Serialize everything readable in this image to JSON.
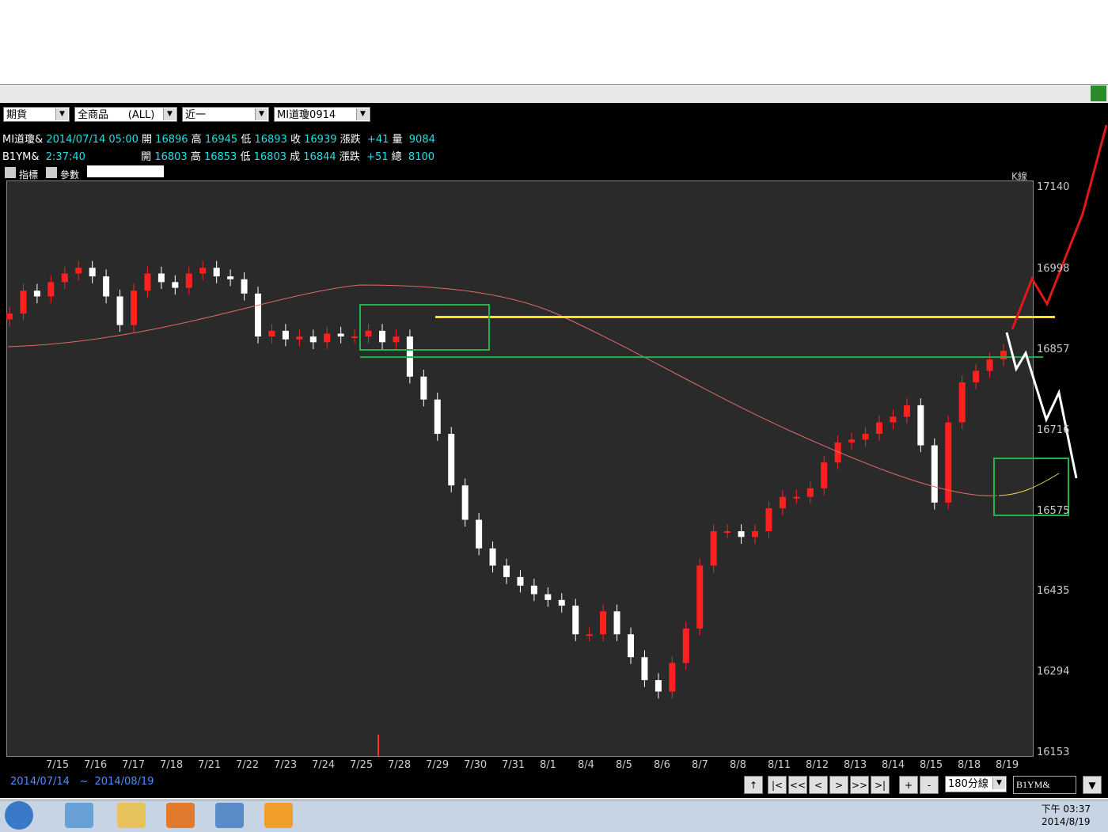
{
  "toolbar": {
    "select_category": "期貨",
    "select_products": "全商品      (ALL)",
    "select_period": "近一",
    "select_symbol": "MI道瓊0914"
  },
  "quote1": {
    "symbol": "MI道瓊&",
    "datetime": "2014/07/14 05:00",
    "open_label": "開",
    "open": "16896",
    "high_label": "高",
    "high": "16945",
    "low_label": "低",
    "low": "16893",
    "close_label": "收",
    "close": "16939",
    "change_label": "漲跌",
    "change": "+41",
    "vol_label": "量",
    "vol": "9084"
  },
  "quote2": {
    "symbol": "B1YM&",
    "time": "2:37:40",
    "open_label": "開",
    "open": "16803",
    "high_label": "高",
    "high": "16853",
    "low_label": "低",
    "low": "16803",
    "close_label": "成",
    "close": "16844",
    "change_label": "漲跌",
    "change": "+51",
    "vol_label": "總",
    "vol": "8100"
  },
  "chart_header": {
    "indicator_label": "指標",
    "param_label": "參數",
    "kline_label": "K線"
  },
  "chart_data": {
    "type": "candlestick",
    "x_labels": [
      "7/15",
      "7/16",
      "7/17",
      "7/18",
      "7/21",
      "7/22",
      "7/23",
      "7/24",
      "7/25",
      "7/28",
      "7/29",
      "7/30",
      "7/31",
      "8/1",
      "8/4",
      "8/5",
      "8/6",
      "8/7",
      "8/8",
      "8/11",
      "8/12",
      "8/13",
      "8/14",
      "8/15",
      "8/18",
      "8/19"
    ],
    "y_ticks": [
      17140,
      16998,
      16857,
      16716,
      16575,
      16435,
      16294,
      16153
    ],
    "ylim": [
      16153,
      17140
    ],
    "close_path": [
      16920,
      16960,
      16950,
      16975,
      16990,
      17000,
      16985,
      16950,
      16900,
      16960,
      16990,
      16975,
      16965,
      16990,
      17000,
      16985,
      16980,
      16955,
      16880,
      16890,
      16875,
      16880,
      16870,
      16885,
      16880,
      16880,
      16890,
      16870,
      16880,
      16810,
      16770,
      16710,
      16620,
      16560,
      16510,
      16480,
      16460,
      16445,
      16430,
      16420,
      16410,
      16360,
      16360,
      16400,
      16360,
      16320,
      16280,
      16260,
      16310,
      16370,
      16480,
      16540,
      16540,
      16530,
      16540,
      16580,
      16600,
      16600,
      16615,
      16660,
      16695,
      16700,
      16710,
      16730,
      16740,
      16760,
      16690,
      16590,
      16730,
      16800,
      16820,
      16840,
      16855
    ],
    "overlay_lines": {
      "yellow_resistance": 16914,
      "green_support": 16844
    },
    "projection_labels": []
  },
  "footer": {
    "date_from": "2014/07/14",
    "tilde": "~",
    "date_to": "2014/08/19",
    "interval": "180分線",
    "symbol_box": "B1YM&",
    "btn_up": "↑",
    "btn_first": "|<",
    "btn_prevfast": "<<",
    "btn_prev": "<",
    "btn_next": ">",
    "btn_nextfast": ">>",
    "btn_last": ">|",
    "btn_plus": "+",
    "btn_minus": "-"
  },
  "taskbar": {
    "clock_line1": "下午 03:37",
    "clock_line2": "2014/8/19"
  }
}
